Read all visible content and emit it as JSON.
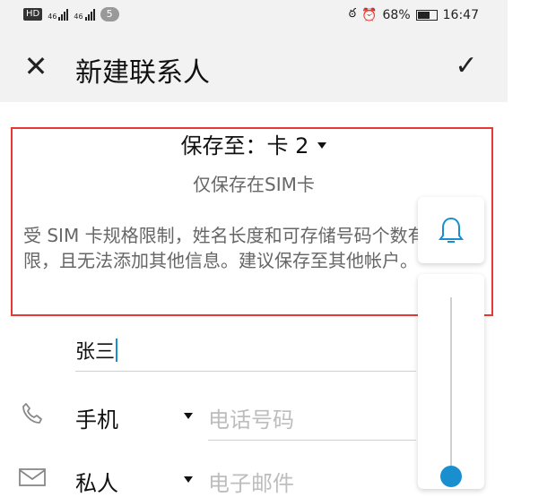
{
  "status_bar": {
    "hd_label": "HD",
    "signal1_label": "46",
    "signal2_label": "46",
    "notification_count": "5",
    "battery_text": "68%",
    "time": "16:47"
  },
  "app_bar": {
    "close_icon": "close-icon",
    "title": "新建联系人",
    "confirm_icon": "check-icon"
  },
  "save_location": {
    "label": "保存至：卡 2",
    "subtitle": "仅保存在SIM卡",
    "notice": "受 SIM 卡规格限制，姓名长度和可存储号码个数有限，且无法添加其他信息。建议保存至其他帐户。"
  },
  "form": {
    "name_value": "张三",
    "phone": {
      "type_label": "手机",
      "placeholder": "电话号码"
    },
    "email": {
      "type_label": "私人",
      "placeholder": "电子邮件"
    }
  },
  "volume_panel": {
    "bell_icon": "bell-icon",
    "level_percent": 0
  },
  "colors": {
    "highlight": "#e53935",
    "accent": "#1a8fd0"
  }
}
